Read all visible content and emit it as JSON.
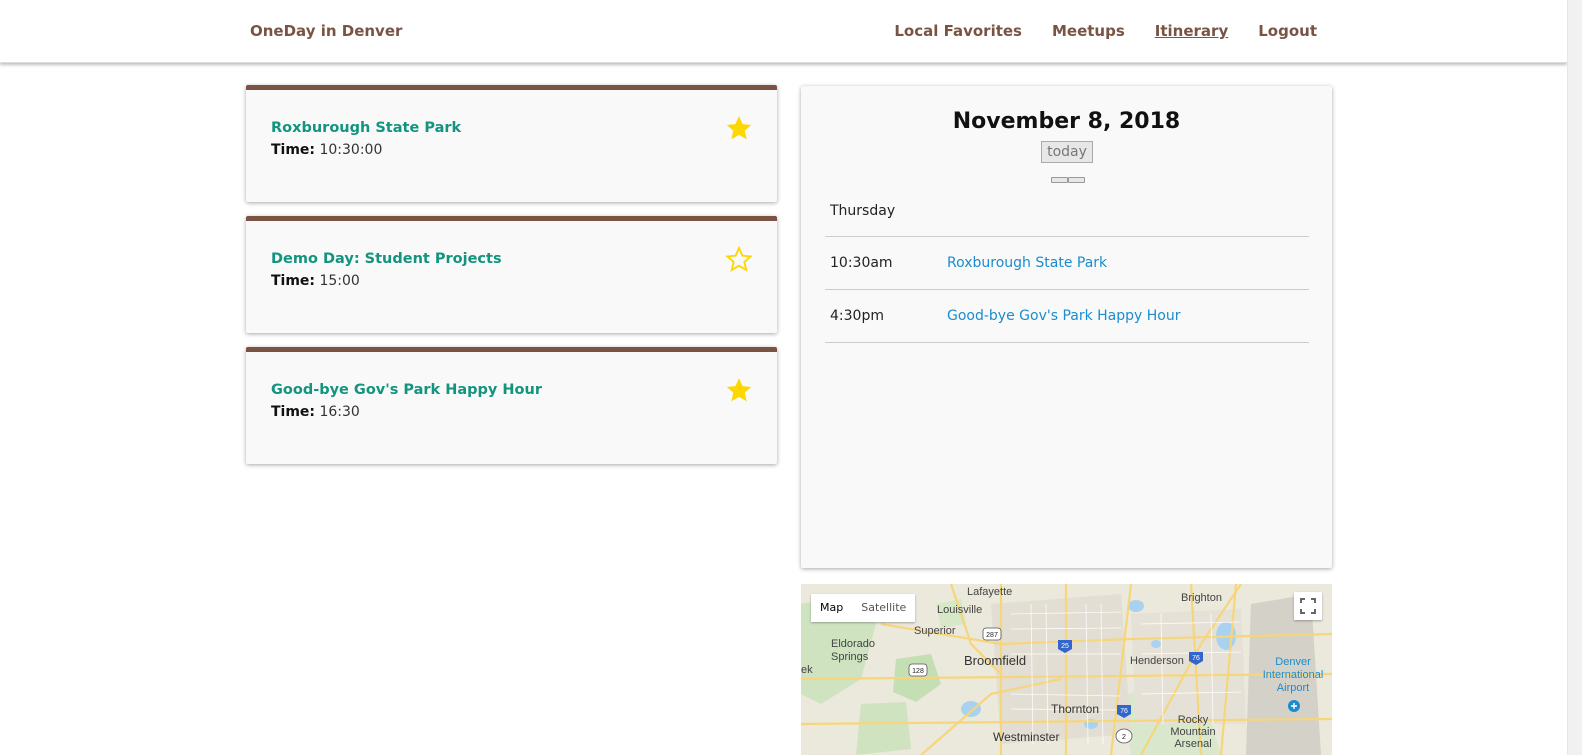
{
  "nav": {
    "brand": "OneDay in Denver",
    "links": [
      "Local Favorites",
      "Meetups",
      "Itinerary",
      "Logout"
    ]
  },
  "events": [
    {
      "title": "Roxburough State Park",
      "time_label": "Time:",
      "time": "10:30:00",
      "starred": true
    },
    {
      "title": "Demo Day: Student Projects",
      "time_label": "Time:",
      "time": "15:00",
      "starred": false
    },
    {
      "title": "Good-bye Gov's Park Happy Hour",
      "time_label": "Time:",
      "time": "16:30",
      "starred": true
    }
  ],
  "calendar": {
    "title": "November 8, 2018",
    "today_label": "today",
    "day": "Thursday",
    "entries": [
      {
        "time": "10:30am",
        "name": "Roxburough State Park"
      },
      {
        "time": "4:30pm",
        "name": "Good-bye Gov's Park Happy Hour"
      }
    ]
  },
  "map": {
    "type_map": "Map",
    "type_satellite": "Satellite",
    "labels": [
      "Lafayette",
      "Louisville",
      "Brighton",
      "Superior",
      "Eldorado Springs",
      "Broomfield",
      "Henderson",
      "Denver International Airport",
      "Thornton",
      "Rocky Mountain Arsenal",
      "Westminster",
      "ek"
    ],
    "shields": [
      "287",
      "25",
      "76",
      "128",
      "76",
      "2"
    ]
  },
  "colors": {
    "brand": "#7a5443",
    "title": "#13947e",
    "link": "#1a8ccf",
    "star": "#ffd700"
  }
}
